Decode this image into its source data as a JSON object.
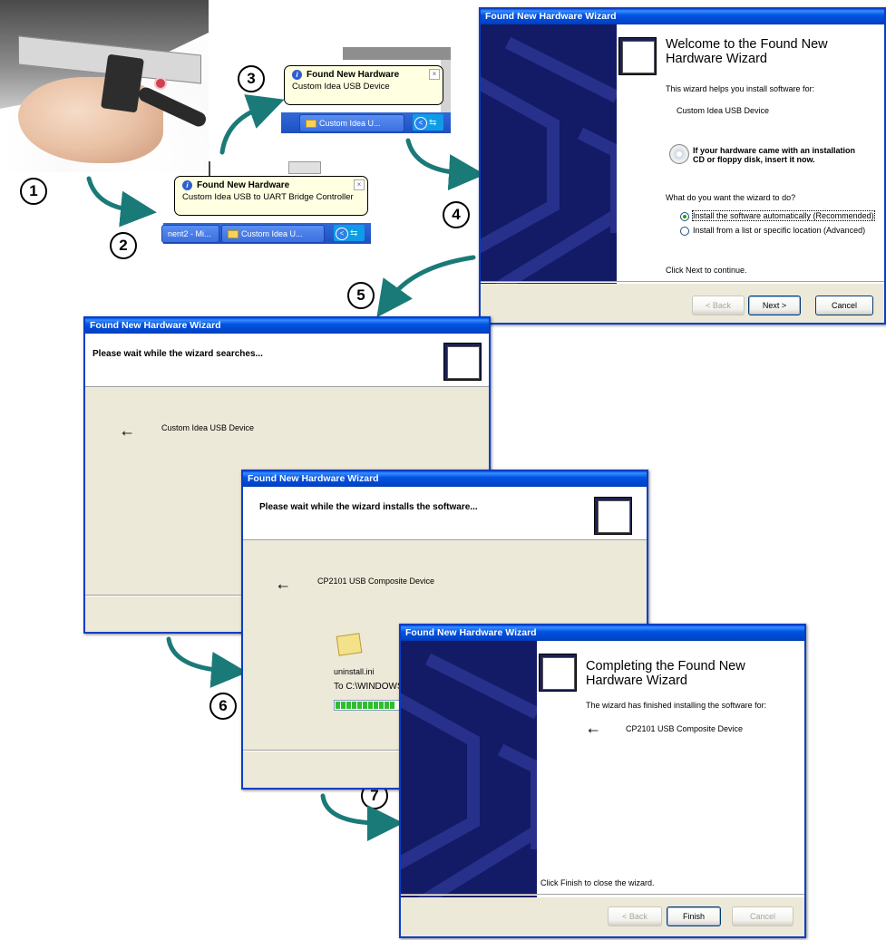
{
  "steps": [
    "1",
    "2",
    "3",
    "4",
    "5",
    "6",
    "7"
  ],
  "balloon_bridge": {
    "title": "Found New Hardware",
    "message": "Custom Idea USB to UART Bridge Controller",
    "taskbar_items": [
      "nent2 - Mi...",
      "Custom Idea U..."
    ],
    "close": "×"
  },
  "balloon_device": {
    "title": "Found New Hardware",
    "message": "Custom Idea USB Device",
    "taskbar_items": [
      "Custom Idea U..."
    ],
    "close": "×"
  },
  "wizard_welcome": {
    "title": "Found New Hardware Wizard",
    "heading": "Welcome to the Found New Hardware Wizard",
    "intro": "This wizard helps you install software for:",
    "device": "Custom Idea USB Device",
    "cd_hint": "If your hardware came with an installation CD or floppy disk, insert it now.",
    "question": "What do you want the wizard to do?",
    "options": [
      "Install the software automatically (Recommended)",
      "Install from a list or specific location (Advanced)"
    ],
    "continue_text": "Click Next to continue.",
    "buttons": {
      "back": "< Back",
      "next": "Next >",
      "cancel": "Cancel"
    }
  },
  "wizard_search": {
    "title": "Found New Hardware Wizard",
    "heading": "Please wait while the wizard searches...",
    "device": "Custom Idea USB Device"
  },
  "wizard_install": {
    "title": "Found New Hardware Wizard",
    "heading": "Please wait while the wizard installs the software...",
    "device": "CP2101 USB Composite Device",
    "file": "uninstall.ini",
    "destination": "To C:\\WINDOWS",
    "progress": 0.55
  },
  "wizard_complete": {
    "title": "Found New Hardware Wizard",
    "heading": "Completing the Found New Hardware Wizard",
    "message": "The wizard has finished installing the software for:",
    "device": "CP2101 USB Composite Device",
    "finish_text": "Click Finish to close the wizard.",
    "buttons": {
      "back": "< Back",
      "finish": "Finish",
      "cancel": "Cancel"
    }
  }
}
